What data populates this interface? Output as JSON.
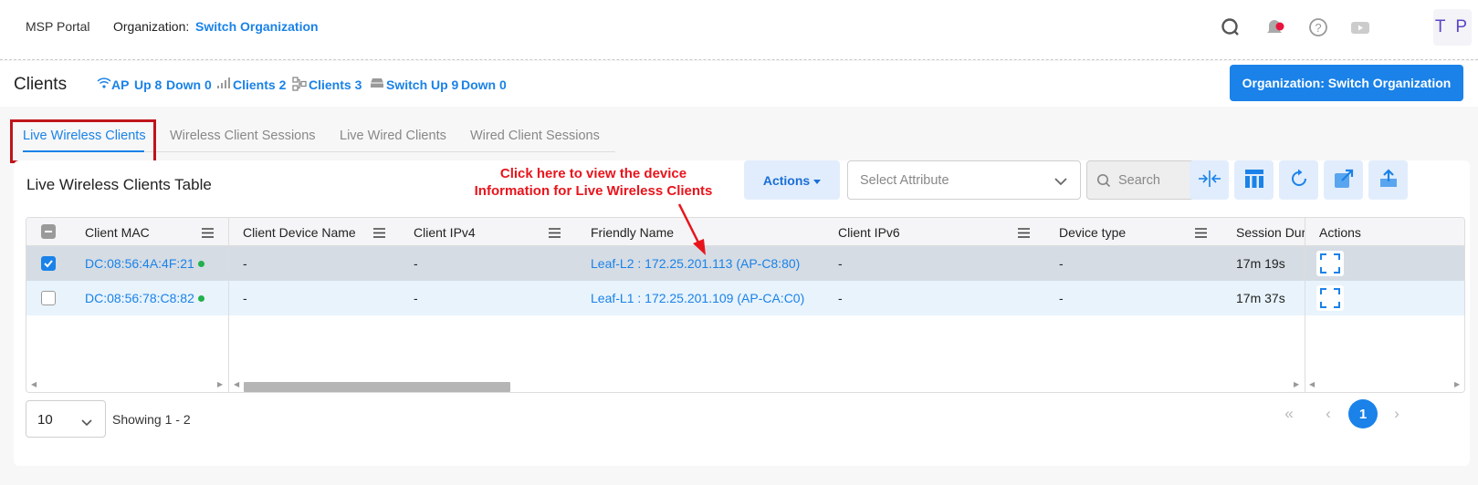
{
  "topbar": {
    "brand": "MSP Portal",
    "org_label": "Organization:",
    "org_link": "Switch Organization",
    "icons": [
      "search-icon",
      "notification-bell-icon",
      "help-icon",
      "video-icon"
    ],
    "notification_dot_color": "#e8143c",
    "avatar_initials": "T P"
  },
  "subheader": {
    "title": "Clients",
    "stats": {
      "ap_label": "AP",
      "ap_up": "Up 8",
      "ap_down": "Down 0",
      "clients_wireless": "Clients 2",
      "clients_wired": "Clients 3",
      "switch_up": "Switch Up 9",
      "switch_down": "Down 0"
    },
    "primary_button": "Organization: Switch Organization"
  },
  "tabs": [
    {
      "label": "Live Wireless Clients",
      "active": true
    },
    {
      "label": "Wireless Client Sessions",
      "active": false
    },
    {
      "label": "Live Wired Clients",
      "active": false
    },
    {
      "label": "Wired Client Sessions",
      "active": false
    }
  ],
  "card": {
    "title": "Live Wireless Clients Table",
    "annotation_line1": "Click here to view the device",
    "annotation_line2": "Information for Live Wireless Clients",
    "actions_label": "Actions",
    "select_placeholder": "Select Attribute",
    "search_placeholder": "Search",
    "tool_icons": [
      "collapse-columns-icon",
      "column-layout-icon",
      "refresh-icon",
      "open-external-icon",
      "export-icon"
    ]
  },
  "table": {
    "columns": [
      "Client MAC",
      "Client Device Name",
      "Client IPv4",
      "Friendly Name",
      "Client IPv6",
      "Device type",
      "Session Dura",
      "Actions"
    ],
    "rows": [
      {
        "selected": true,
        "mac": "DC:08:56:4A:4F:21",
        "device_name": "-",
        "ipv4": "-",
        "friendly_name": "Leaf-L2 : 172.25.201.113 (AP-C8:80)",
        "ipv6": "-",
        "device_type": "-",
        "session": "17m 19s"
      },
      {
        "selected": false,
        "mac": "DC:08:56:78:C8:82",
        "device_name": "-",
        "ipv4": "-",
        "friendly_name": "Leaf-L1 : 172.25.201.109 (AP-CA:C0)",
        "ipv6": "-",
        "device_type": "-",
        "session": "17m 37s"
      }
    ]
  },
  "footer": {
    "page_size": "10",
    "showing": "Showing 1 - 2",
    "current_page": "1"
  },
  "colors": {
    "accent": "#1a82e8",
    "annotation_red": "#e8141c",
    "online_green": "#22b14c"
  }
}
